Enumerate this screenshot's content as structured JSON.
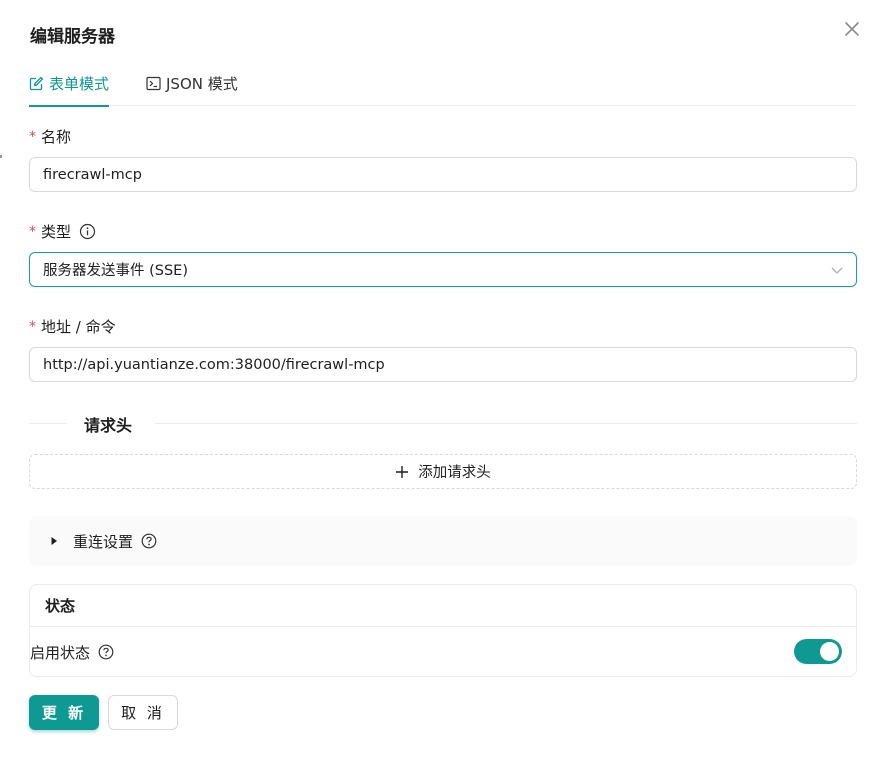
{
  "dialog": {
    "title": "编辑服务器",
    "close_icon": "close-icon"
  },
  "tabs": [
    {
      "label": "表单模式",
      "icon": "edit-icon",
      "active": true
    },
    {
      "label": "JSON 模式",
      "icon": "terminal-icon",
      "active": false
    }
  ],
  "fields": {
    "name": {
      "label": "名称",
      "required": true,
      "value": "firecrawl-mcp"
    },
    "type": {
      "label": "类型",
      "required": true,
      "value": "服务器发送事件 (SSE)",
      "info_icon": "info-icon"
    },
    "address": {
      "label": "地址 / 命令",
      "required": true,
      "value": "http://api.yuantianze.com:38000/firecrawl-mcp"
    }
  },
  "headers_section": {
    "title": "请求头",
    "add_label": "添加请求头"
  },
  "reconnect": {
    "label": "重连设置",
    "expanded": false
  },
  "status": {
    "title": "状态",
    "enabled_label": "启用状态",
    "enabled": true
  },
  "actions": {
    "update_label": "更 新",
    "cancel_label": "取 消"
  },
  "colors": {
    "accent": "#0e9a92",
    "required": "#e5484d"
  }
}
